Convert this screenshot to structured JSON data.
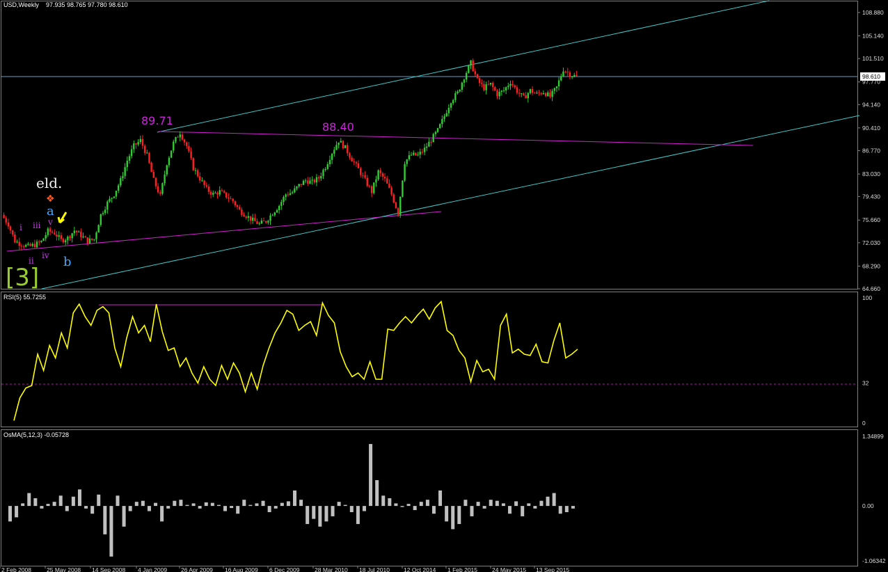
{
  "header": {
    "title": "USD,Weekly",
    "ohlc": "97.935 98.765 97.780 98.610"
  },
  "price_panel": {
    "last_price": "98.610",
    "y_ticks": [
      "108.880",
      "105.140",
      "101.510",
      "97.770",
      "94.140",
      "90.410",
      "86.770",
      "83.030",
      "79.430",
      "75.660",
      "72.030",
      "68.290",
      "64.660"
    ],
    "annotations": {
      "peak1": "89.71",
      "peak2": "88.40",
      "eld": "eld.",
      "wave_a": "a",
      "wave_b": "b",
      "wave_i": "i",
      "wave_ii": "ii",
      "wave_iii": "iii",
      "wave_iv": "iv",
      "wave_v": "v",
      "degree": "[3]"
    }
  },
  "rsi_panel": {
    "label": "RSI(5) 55.7255",
    "y_ticks": [
      "100",
      "32",
      "0"
    ]
  },
  "osma_panel": {
    "label": "OsMA(5,12,3) -0.05728",
    "y_ticks": [
      "1.34899",
      "0.00",
      "-1.06342"
    ]
  },
  "x_axis": {
    "labels": [
      "2 Feb 2008",
      "25 May 2008",
      "14 Sep 2008",
      "4 Jan 2009",
      "26 Apr 2009",
      "16 Aug 2009",
      "6 Dec 2009",
      "28 Mar 2010",
      "18 Jul 2010",
      "12 Oct 2014",
      "1 Feb 2015",
      "24 May 2015",
      "13 Sep 2015"
    ]
  },
  "colors": {
    "up": "#32cd32",
    "down": "#ff2020",
    "channel": "#40c8c8",
    "trendline": "#d020d0",
    "rsi": "#ffff00",
    "osma": "#c0c0c0",
    "label_magenta": "#d020e0",
    "wave_blue": "#40a8ff",
    "degree_green": "#9acd32"
  },
  "chart_data": [
    {
      "type": "line",
      "title": "USD,Weekly",
      "xlabel": "",
      "ylabel": "",
      "ylim": [
        64.66,
        110.7
      ],
      "series": [
        {
          "name": "USD,Weekly",
          "values": [
            76.5,
            75.0,
            72.3,
            71.8,
            71.4,
            71.7,
            72.2,
            73.9,
            73.6,
            72.4,
            72.8,
            74.0,
            73.2,
            72.3,
            72.6,
            76.5,
            78.4,
            79.8,
            82.0,
            85.2,
            87.5,
            88.4,
            86.0,
            82.0,
            79.5,
            84.8,
            88.0,
            89.7,
            87.5,
            84.0,
            82.3,
            80.6,
            79.8,
            80.2,
            79.5,
            78.7,
            77.2,
            76.4,
            75.6,
            75.0,
            75.5,
            76.8,
            78.0,
            79.8,
            80.1,
            81.2,
            82.0,
            81.7,
            82.4,
            84.2,
            86.5,
            88.4,
            87.2,
            85.4,
            83.8,
            82.0,
            80.2,
            83.4,
            82.1,
            79.8,
            76.8,
            85.0,
            86.1,
            86.0,
            87.0,
            88.5,
            90.0,
            92.3,
            94.8,
            96.0,
            98.6,
            100.8,
            98.0,
            96.8,
            97.4,
            95.8,
            96.4,
            97.8,
            96.3,
            95.2,
            96.4,
            95.8,
            96.2,
            95.4,
            96.9,
            99.8,
            99.0,
            98.6
          ]
        }
      ]
    },
    {
      "type": "line",
      "title": "RSI(5) 55.7255",
      "xlabel": "",
      "ylabel": "",
      "ylim": [
        0,
        100
      ],
      "series": [
        {
          "name": "RSI(5)",
          "values": [
            2,
            20,
            28,
            30,
            55,
            42,
            62,
            52,
            72,
            60,
            88,
            95,
            85,
            78,
            90,
            93,
            88,
            60,
            45,
            68,
            85,
            72,
            78,
            65,
            95,
            73,
            58,
            60,
            45,
            52,
            40,
            32,
            45,
            35,
            30,
            46,
            35,
            48,
            40,
            25,
            40,
            27,
            46,
            60,
            72,
            80,
            90,
            87,
            74,
            78,
            81,
            70,
            96,
            86,
            80,
            57,
            45,
            37,
            40,
            35,
            49,
            35,
            35,
            75,
            74,
            80,
            85,
            80,
            86,
            91,
            83,
            92,
            97,
            74,
            70,
            58,
            52,
            33,
            50,
            41,
            43,
            35,
            78,
            87,
            56,
            59,
            55,
            54,
            63,
            49,
            48,
            66,
            80,
            52,
            55,
            59
          ]
        }
      ]
    },
    {
      "type": "bar",
      "title": "OsMA(5,12,3) -0.05728",
      "xlabel": "",
      "ylabel": "",
      "ylim": [
        -1.06342,
        1.34899
      ],
      "series": [
        {
          "name": "OsMA(5,12,3)",
          "values": [
            -0.3,
            -0.22,
            0.05,
            0.25,
            0.15,
            -0.05,
            0.04,
            0.08,
            0.2,
            -0.1,
            0.18,
            0.32,
            -0.05,
            -0.15,
            0.22,
            -0.55,
            -0.98,
            0.2,
            -0.4,
            -0.1,
            0.08,
            0.1,
            -0.1,
            0.06,
            -0.3,
            -0.05,
            0.1,
            0.12,
            0.02,
            0.05,
            -0.05,
            0.07,
            0.06,
            0.02,
            -0.1,
            -0.04,
            -0.15,
            0.12,
            0.02,
            0.05,
            0.1,
            -0.12,
            -0.05,
            0.06,
            0.09,
            0.3,
            0.12,
            -0.35,
            -0.25,
            -0.4,
            -0.3,
            -0.2,
            0.08,
            0.02,
            -0.12,
            -0.35,
            -0.1,
            1.2,
            0.5,
            0.2,
            0.15,
            0.05,
            -0.02,
            0.04,
            -0.08,
            0.08,
            0.12,
            -0.15,
            0.3,
            -0.3,
            -0.45,
            -0.35,
            0.12,
            -0.2,
            0.08,
            -0.05,
            0.12,
            0.1,
            0.05,
            -0.15,
            0.09,
            -0.2,
            0.05,
            -0.05,
            0.1,
            0.18,
            0.25,
            -0.15,
            -0.12,
            -0.05
          ]
        }
      ]
    }
  ]
}
